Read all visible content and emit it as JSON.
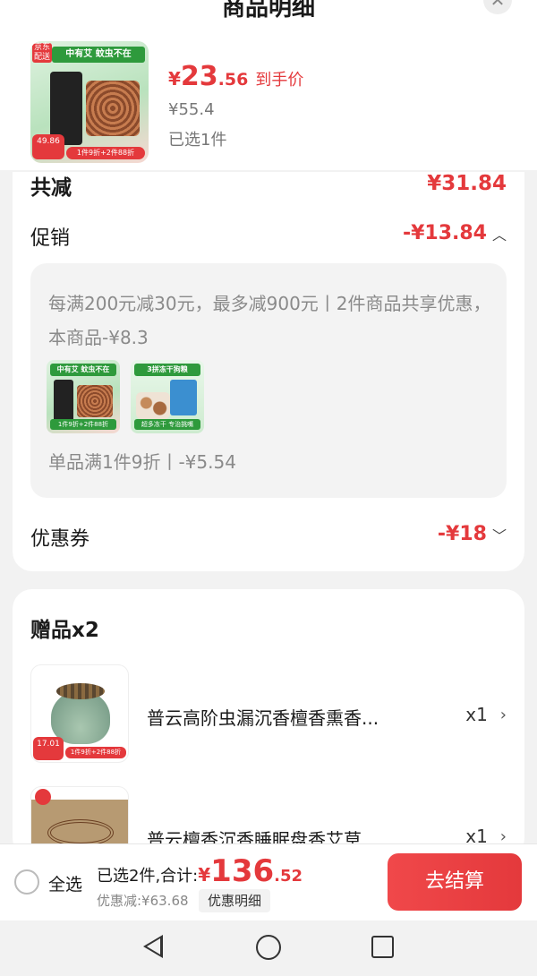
{
  "sheet": {
    "title": "商品明细"
  },
  "product": {
    "thumb": {
      "tag": "京东配送",
      "banner": "中有艾 蚊虫不在",
      "price_badge": "49.86",
      "deal": "1件9折+2件88折"
    },
    "price_currency": "¥",
    "price_int": "23",
    "price_dec": ".56",
    "price_label": "到手价",
    "original_price": "¥55.4",
    "selected": "已选1件"
  },
  "discount": {
    "total_label": "共减",
    "total_value": "¥31.84",
    "promo_label": "促销",
    "promo_value": "-¥13.84",
    "promo_text": "每满200元减30元，最多减900元丨2件商品共享优惠，本商品-¥8.3",
    "mini1": {
      "banner": "中有艾 蚊虫不在",
      "deal": "1件9折+2件88折"
    },
    "mini2": {
      "banner": "3拼冻干狗粮",
      "deal": "超多冻干 专治挑嘴"
    },
    "promo_sub": "单品满1件9折丨-¥5.54",
    "coupon_label": "优惠券",
    "coupon_value": "-¥18"
  },
  "gifts": {
    "title": "赠品x2",
    "items": [
      {
        "name": "普云高阶虫漏沉香檀香熏香...",
        "qty": "x1",
        "price_badge": "17.01",
        "deal": "1件9折+2件88折"
      },
      {
        "name": "普云檀香沉香睡眠盘香艾草...",
        "qty": "x1"
      }
    ]
  },
  "bottom": {
    "select_all": "全选",
    "total_label": "已选2件,合计:",
    "total_currency": "¥",
    "total_int": "136",
    "total_dec": ".52",
    "discount": "优惠减:¥63.68",
    "detail_link": "优惠明细",
    "checkout": "去结算"
  },
  "icons": {
    "close": "close-icon",
    "chevron_up": "chevron-up-icon",
    "chevron_down": "chevron-down-icon",
    "chevron_right": "chevron-right-icon"
  },
  "colors": {
    "accent": "#e4393c",
    "muted": "#8a8a8a"
  }
}
